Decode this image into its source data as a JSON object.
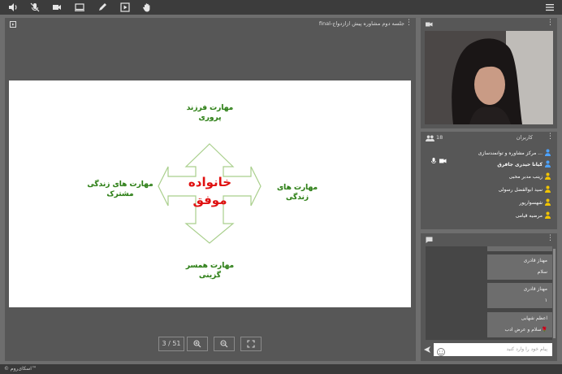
{
  "toolbar": {
    "icons": [
      "speaker-icon",
      "mic-muted-icon",
      "camera-icon",
      "screen-share-icon",
      "pen-icon",
      "media-icon",
      "hand-icon",
      "menu-icon"
    ]
  },
  "presentation": {
    "title": "جلسه دوم مشاوره پیش ازازدواج-final",
    "slide": {
      "top_skill": "مهارت فرزند پروری",
      "left_skill": "مهارت های زندگی مشترک",
      "right_skill": "مهارت های زندگی",
      "bottom_skill": "مهارت همسر گزینی",
      "center_line1": "خانواده",
      "center_line2": "موفق"
    },
    "page_indicator": "3 / 51"
  },
  "users": {
    "header_label": "کاربران",
    "count": "18",
    "list": [
      {
        "name": "مرکز مشاوره و توانمندسازی ...",
        "bold": false,
        "color": "#4da3ff"
      },
      {
        "name": "کیانا حیدری جافرق",
        "bold": true,
        "color": "#4da3ff"
      },
      {
        "name": "زینب مدبر محبی",
        "bold": false,
        "color": "#f2c400"
      },
      {
        "name": "سید ابوالفضل رسولی",
        "bold": false,
        "color": "#f2c400"
      },
      {
        "name": "شهسوارپور",
        "bold": false,
        "color": "#f2c400"
      },
      {
        "name": "مرضیه قیامی",
        "bold": false,
        "color": "#f2c400"
      }
    ]
  },
  "chat": {
    "messages": [
      {
        "sender": "مهناز قادری",
        "text": "سلام"
      },
      {
        "sender": "مهناز قادری",
        "text": "۱"
      },
      {
        "sender": "اعظم شهابی",
        "text": "سلام و عرض ادب🌹"
      }
    ],
    "input_placeholder": "پیام خود را وارد کنید"
  },
  "footer": {
    "brand": "© اسکای‌روم™"
  },
  "colors": {
    "slide_text_green": "#2e7d1a",
    "slide_text_red": "#e01010",
    "panel_bg": "#575757"
  }
}
